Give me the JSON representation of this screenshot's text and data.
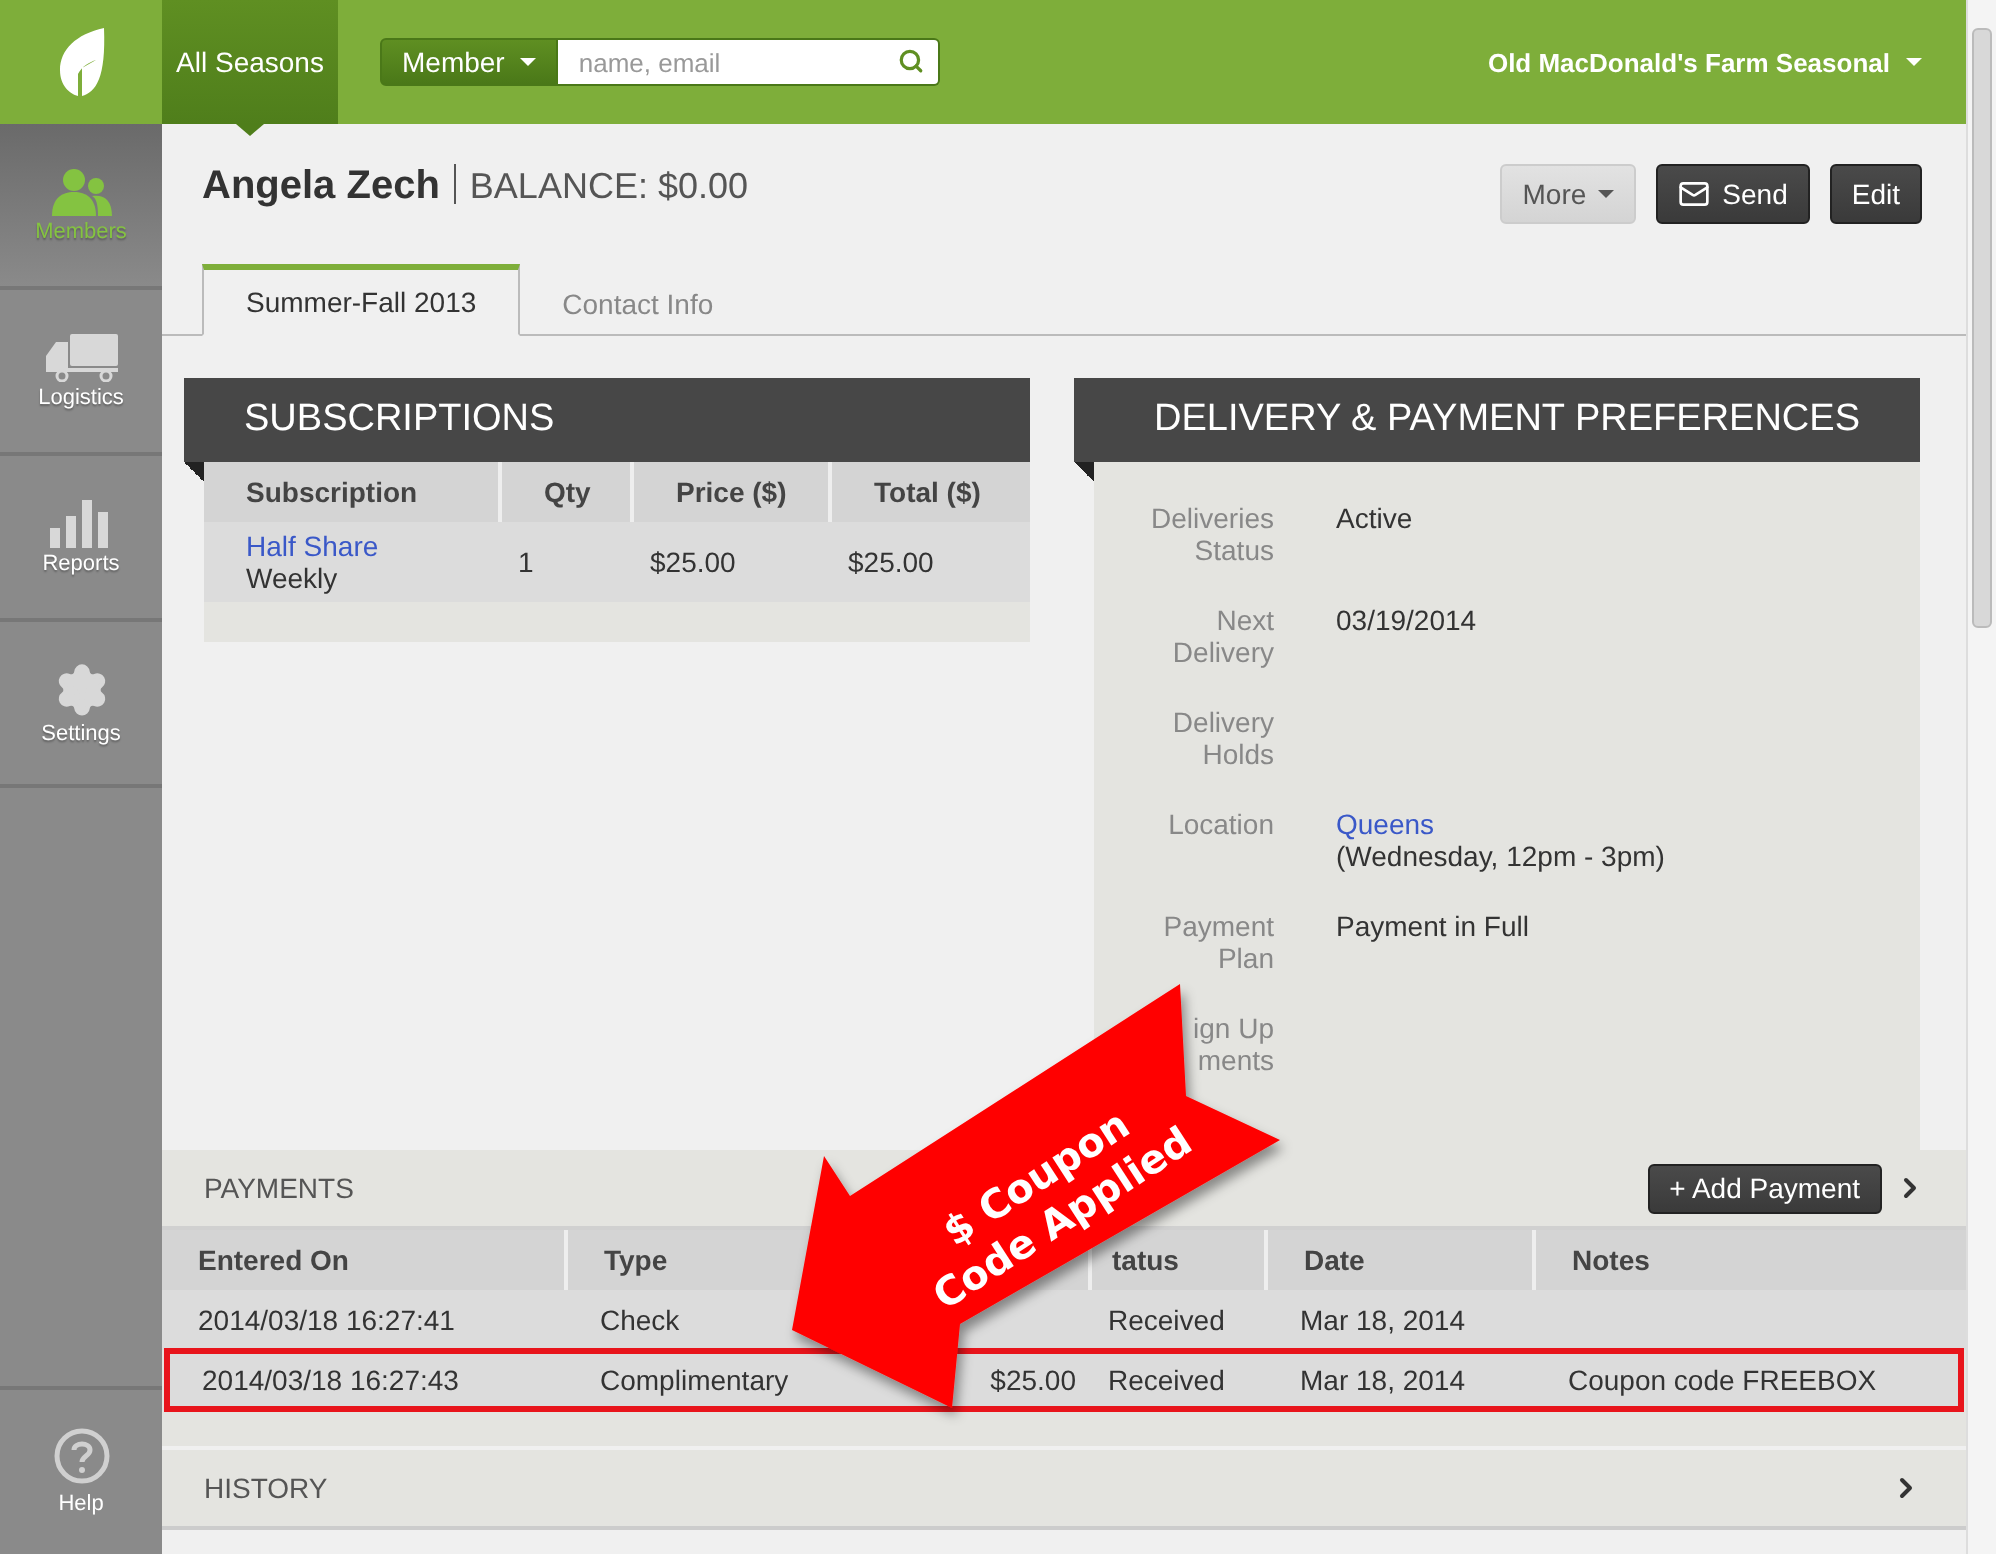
{
  "top_bar": {
    "season_tab": "All Seasons",
    "search_scope": "Member",
    "search": {
      "placeholder": "name, email"
    },
    "farm_menu": "Old MacDonald's Farm Seasonal"
  },
  "sidebar": {
    "items": [
      {
        "label": "Members",
        "selected": true
      },
      {
        "label": "Logistics",
        "selected": false
      },
      {
        "label": "Reports",
        "selected": false
      },
      {
        "label": "Settings",
        "selected": false
      }
    ],
    "help": "Help"
  },
  "member": {
    "name": "Angela Zech",
    "balance": "BALANCE: $0.00"
  },
  "actions": [
    {
      "label": "More",
      "kind": "dropdown"
    },
    {
      "label": "Send",
      "kind": "send"
    },
    {
      "label": "Edit",
      "kind": "plain"
    }
  ],
  "tabs": [
    {
      "label": "Summer-Fall 2013",
      "selected": true
    },
    {
      "label": "Contact Info",
      "selected": false
    }
  ],
  "subscriptions": {
    "title": "SUBSCRIPTIONS",
    "columns": [
      "Subscription",
      "Qty",
      "Price ($)",
      "Total ($)"
    ],
    "rows": [
      {
        "subscription": "Half Share",
        "frequency": "Weekly",
        "qty": "1",
        "price": "$25.00",
        "total": "$25.00"
      }
    ]
  },
  "delivery": {
    "title": "DELIVERY & PAYMENT PREFERENCES",
    "fields": [
      {
        "label": [
          "Deliveries",
          "Status"
        ],
        "value": "Active"
      },
      {
        "label": [
          "Next",
          "Delivery"
        ],
        "value": "03/19/2014"
      },
      {
        "label": [
          "Delivery",
          "Holds"
        ]
      },
      {
        "label": [
          "Location"
        ],
        "link": "Queens",
        "value": "(Wednesday, 12pm - 3pm)"
      },
      {
        "label": [
          "Payment",
          "Plan"
        ],
        "value": "Payment in Full"
      },
      {
        "label": [
          "ign Up",
          "ments"
        ]
      }
    ]
  },
  "payments": {
    "title": "PAYMENTS",
    "add_button": "+ Add Payment",
    "columns": [
      "Entered On",
      "Type",
      null,
      "tatus",
      "Date",
      "Notes"
    ],
    "rows": [
      {
        "cells": [
          "2014/03/18 16:27:41",
          "Check",
          null,
          "Received",
          "Mar 18, 2014",
          null
        ],
        "highlighted": false
      },
      {
        "cells": [
          "2014/03/18 16:27:43",
          "Complimentary",
          "$25.00",
          "Received",
          "Mar 18, 2014",
          "Coupon code FREEBOX"
        ],
        "highlighted": true
      }
    ]
  },
  "history": {
    "title": "HISTORY"
  },
  "callout": {
    "lines": [
      "$ Coupon",
      "Code Applied"
    ]
  }
}
